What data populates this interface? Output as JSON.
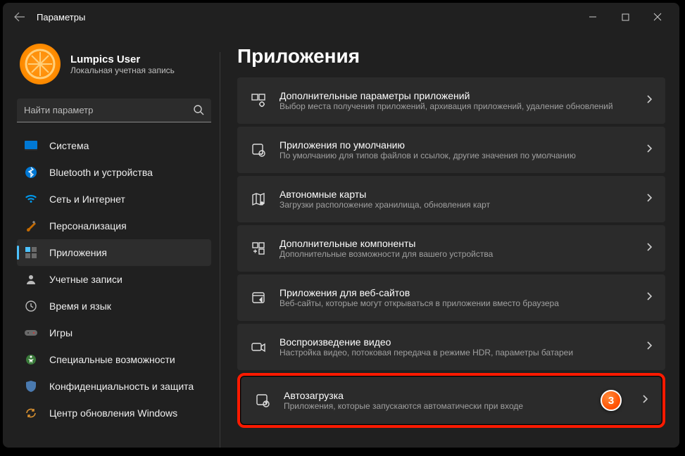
{
  "window": {
    "title": "Параметры"
  },
  "user": {
    "name": "Lumpics User",
    "subtitle": "Локальная учетная запись"
  },
  "search": {
    "placeholder": "Найти параметр"
  },
  "nav": {
    "items": [
      {
        "label": "Система"
      },
      {
        "label": "Bluetooth и устройства"
      },
      {
        "label": "Сеть и Интернет"
      },
      {
        "label": "Персонализация"
      },
      {
        "label": "Приложения"
      },
      {
        "label": "Учетные записи"
      },
      {
        "label": "Время и язык"
      },
      {
        "label": "Игры"
      },
      {
        "label": "Специальные возможности"
      },
      {
        "label": "Конфиденциальность и защита"
      },
      {
        "label": "Центр обновления Windows"
      }
    ]
  },
  "page": {
    "title": "Приложения"
  },
  "cards": [
    {
      "title": "Дополнительные параметры приложений",
      "sub": "Выбор места получения приложений, архивация приложений, удаление обновлений"
    },
    {
      "title": "Приложения по умолчанию",
      "sub": "По умолчанию для типов файлов и ссылок, другие значения по умолчанию"
    },
    {
      "title": "Автономные карты",
      "sub": "Загрузки расположение хранилища, обновления карт"
    },
    {
      "title": "Дополнительные компоненты",
      "sub": "Дополнительные возможности для вашего устройства"
    },
    {
      "title": "Приложения для веб-сайтов",
      "sub": "Веб-сайты, которые могут открываться в приложении вместо браузера"
    },
    {
      "title": "Воспроизведение видео",
      "sub": "Настройка видео, потоковая передача в режиме HDR, параметры батареи"
    },
    {
      "title": "Автозагрузка",
      "sub": "Приложения, которые запускаются автоматически при входе"
    }
  ],
  "step_badge": "3"
}
